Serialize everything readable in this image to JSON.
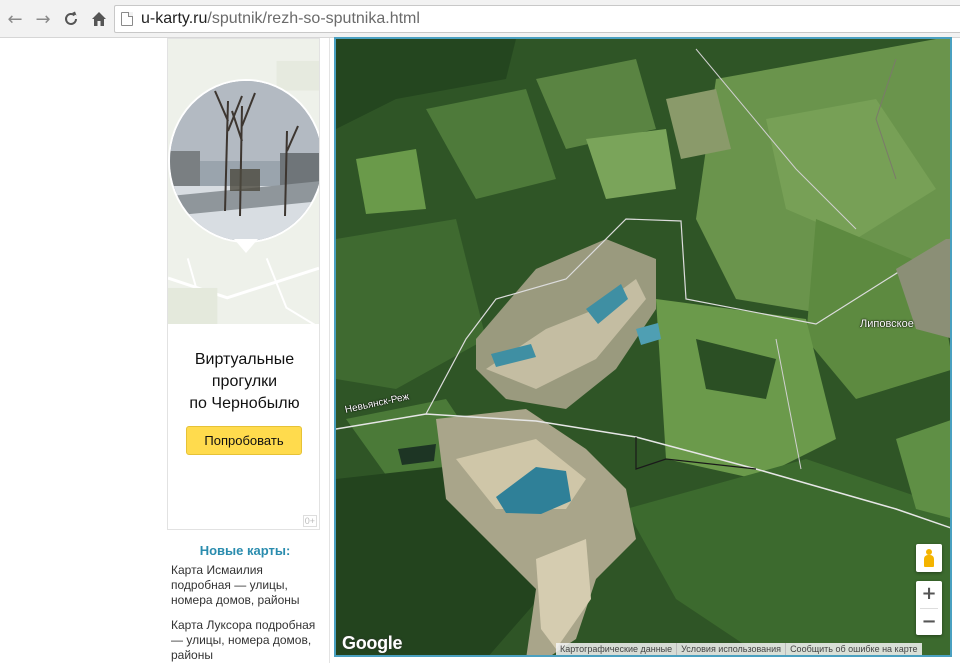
{
  "browser": {
    "url_host": "u-karty.ru",
    "url_path": "/sputnik/rezh-so-sputnika.html",
    "icons": [
      "back-arrow-icon",
      "forward-arrow-icon",
      "reload-icon",
      "home-icon",
      "page-icon"
    ]
  },
  "ad": {
    "title_line1": "Виртуальные",
    "title_line2": "прогулки",
    "title_line3": "по Чернобылю",
    "button": "Попробовать",
    "mark": "0+"
  },
  "sidebar": {
    "new_maps_title": "Новые карты:",
    "items": [
      {
        "text": "Карта Исмаилия подробная — улицы, номера домов, районы"
      },
      {
        "text": "Карта Луксора подробная — улицы, номера домов, районы"
      }
    ]
  },
  "map": {
    "road_label": "Невьянск-Реж",
    "village_label": "Липовское",
    "logo": "Google",
    "zoom_in": "+",
    "zoom_out": "−",
    "attribution": [
      "Картографические данные",
      "Условия использования",
      "Сообщить об ошибке на карте"
    ],
    "colors": {
      "frame": "#4aa0c0",
      "water": "#3f8fa3",
      "quarry": "#b9b29a"
    }
  }
}
